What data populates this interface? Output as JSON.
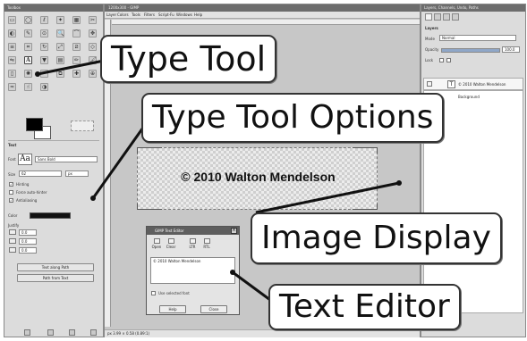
{
  "toolbox": {
    "title": "Toolbox",
    "tool_options_title": "Text",
    "font_label": "Font",
    "font_value": "Sans Bold",
    "font_preview": "Aa",
    "size_label": "Size",
    "size_value": "62",
    "size_unit": "px",
    "hinting_label": "Hinting",
    "force_autohinter_label": "Force auto-hinter",
    "antialiasing_label": "Antialiasing",
    "color_label": "Color",
    "justify_label": "Justify",
    "spacing_values": [
      "0.0",
      "0.0",
      "0.0"
    ],
    "text_along_path_label": "Text along Path",
    "path_from_text_label": "Path from Text"
  },
  "image_window": {
    "title": "1200x300 - GIMP",
    "menu": [
      "Layer",
      "Colors",
      "Tools",
      "Filters",
      "Script-Fu",
      "Windows",
      "Help"
    ],
    "canvas_text": "© 2010 Walton Mendelson",
    "status_text": "px  3.99 × 0.58 (0.89:1)"
  },
  "text_editor": {
    "title": "GIMP Text Editor",
    "open_label": "Open",
    "clear_label": "Clear",
    "ltr_label": "LTR",
    "rtl_label": "RTL",
    "content": "© 2010 Walton Mendelson",
    "use_selected_font_label": "Use selected font",
    "help_label": "Help",
    "close_label": "Close"
  },
  "layers_dock": {
    "title": "Layers, Channels, Undo, Paths",
    "panel_title": "Layers",
    "mode_label": "Mode",
    "mode_value": "Normal",
    "opacity_label": "Opacity",
    "opacity_value": "100.0",
    "lock_label": "Lock",
    "layer_name": "© 2010 Walton Mendelson",
    "background_layer": "Background"
  },
  "callouts": {
    "type_tool": "Type Tool",
    "type_tool_options": "Type Tool Options",
    "image_display": "Image Display",
    "text_editor": "Text Editor"
  },
  "colors": {
    "window_chrome": "#6d6d6d",
    "panel_bg": "#dcdcdc",
    "canvas_bg": "#c7c7c7",
    "callout_border": "#333333"
  },
  "icons": [
    "rect-select-icon",
    "ellipse-select-icon",
    "free-select-icon",
    "fuzzy-select-icon",
    "by-color-select-icon",
    "scissors-icon",
    "foreground-select-icon",
    "paths-icon",
    "color-picker-icon",
    "zoom-icon",
    "measure-icon",
    "move-icon",
    "align-icon",
    "crop-icon",
    "rotate-icon",
    "scale-icon",
    "shear-icon",
    "perspective-icon",
    "flip-icon",
    "text-icon",
    "bucket-fill-icon",
    "blend-icon",
    "pencil-icon",
    "paintbrush-icon",
    "eraser-icon",
    "airbrush-icon",
    "ink-icon",
    "clone-icon",
    "heal-icon",
    "perspective-clone-icon",
    "blur-icon",
    "smudge-icon",
    "dodge-burn-icon"
  ]
}
